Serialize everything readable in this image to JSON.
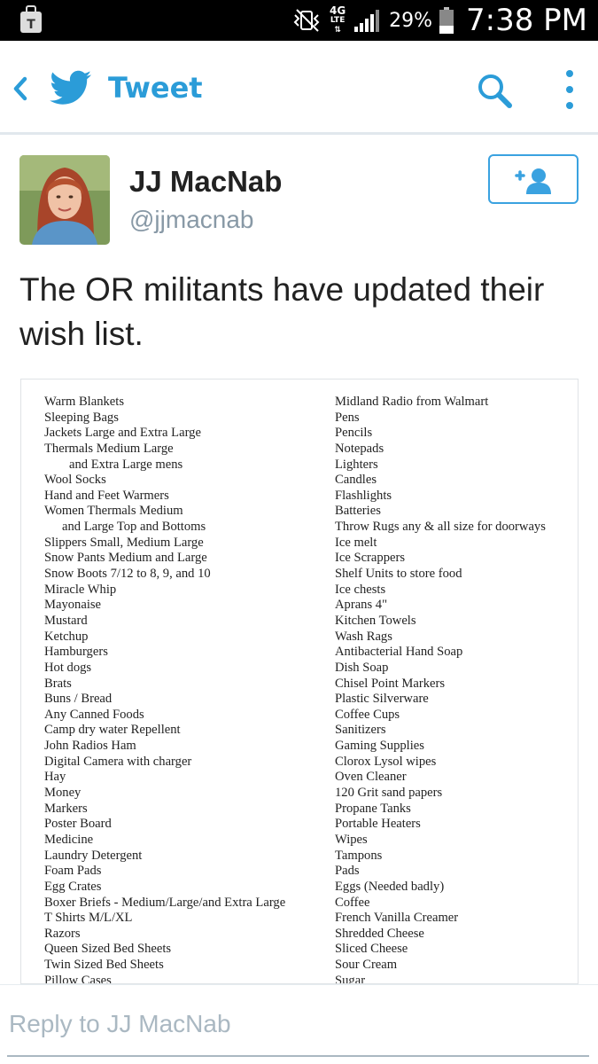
{
  "status_bar": {
    "network_top": "4G",
    "network_bottom": "LTE",
    "battery": "29%",
    "time": "7:38 PM"
  },
  "topbar": {
    "title": "Tweet",
    "icons": [
      "back-icon",
      "twitter-bird-icon",
      "search-icon",
      "more-vertical-icon"
    ]
  },
  "tweet": {
    "author_name": "JJ MacNab",
    "author_handle": "@jjmacnab",
    "text": "The OR militants have updated their wish list.",
    "follow_icon": "add-user-icon"
  },
  "wish_list": {
    "left": [
      "Warm Blankets",
      "Sleeping Bags",
      "Jackets Large and Extra Large",
      "Thermals Medium Large",
      "and Extra Large mens",
      "Wool Socks",
      "Hand and Feet Warmers",
      "Women Thermals Medium",
      "and Large Top and Bottoms",
      "Slippers Small, Medium Large",
      "Snow Pants Medium and Large",
      "Snow Boots 7/12 to 8, 9, and 10",
      "Miracle Whip",
      "Mayonaise",
      "Mustard",
      "Ketchup",
      "Hamburgers",
      "Hot dogs",
      "Brats",
      "Buns  / Bread",
      "Any Canned Foods",
      "Camp dry water Repellent",
      "John Radios Ham",
      "Digital Camera with charger",
      "Hay",
      "Money",
      "Markers",
      "Poster Board",
      "Medicine",
      "Laundry Detergent",
      "Foam Pads",
      "Egg Crates",
      "Boxer Briefs - Medium/Large/and Extra Large",
      "T Shirts M/L/XL",
      "Razors",
      "Queen Sized Bed Sheets",
      "Twin Sized Bed Sheets",
      "Pillow Cases"
    ],
    "right": [
      "Midland Radio from Walmart",
      "Pens",
      "Pencils",
      "Notepads",
      "Lighters",
      "Candles",
      "Flashlights",
      "Batteries",
      "Throw Rugs any & all size for doorways",
      "Ice melt",
      "Ice Scrappers",
      "Shelf Units to store food",
      "Ice chests",
      "Aprans 4\"",
      "Kitchen Towels",
      "Wash Rags",
      "Antibacterial Hand Soap",
      "Dish Soap",
      "Chisel Point Markers",
      "Plastic Silverware",
      "Coffee Cups",
      "Sanitizers",
      "Gaming Supplies",
      "Clorox Lysol wipes",
      "Oven Cleaner",
      "120 Grit sand papers",
      "Propane Tanks",
      "Portable Heaters",
      "Wipes",
      "Tampons",
      "Pads",
      "Eggs (Needed badly)",
      "Coffee",
      "French Vanilla Creamer",
      "Shredded Cheese",
      "Sliced Cheese",
      "Sour Cream",
      "Sugar"
    ]
  },
  "reply": {
    "placeholder": "Reply to JJ MacNab"
  },
  "colors": {
    "twitter_blue": "#2b9cd8",
    "handle_gray": "#8899a6"
  }
}
